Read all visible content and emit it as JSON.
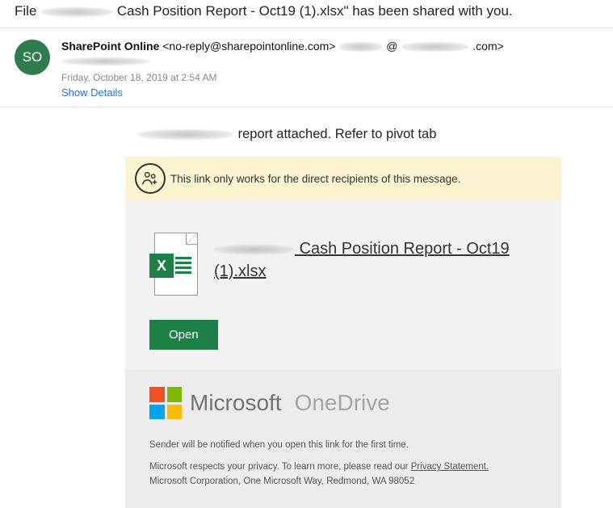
{
  "subject": {
    "prefix": "File ",
    "suffix": " Cash Position Report - Oct19 (1).xlsx\" has been shared with you."
  },
  "avatar": "SO",
  "from": {
    "name": "SharePoint Online",
    "email_prefix": "<no-reply@sharepointonline.com>",
    "at": "@",
    "domain_suffix": ".com>"
  },
  "date": "Friday, October 18, 2019 at 2:54 AM",
  "details_label": "Show Details",
  "intro_suffix": " report attached. Refer to pivot tab",
  "banner_text": "This link only works for the direct recipients of this message.",
  "file": {
    "name_part1": " Cash Position Report - Oct19 ",
    "name_part2": "(1).xlsx"
  },
  "open_label": "Open",
  "brand": {
    "microsoft": "Microsoft",
    "onedrive": "OneDrive"
  },
  "footer": {
    "line1": "Sender will be notified when you open this link for the first time.",
    "line2a": "Microsoft respects your privacy. To learn more, please read our ",
    "privacy": "Privacy Statement.",
    "line3": "Microsoft Corporation, One Microsoft Way, Redmond, WA 98052"
  }
}
